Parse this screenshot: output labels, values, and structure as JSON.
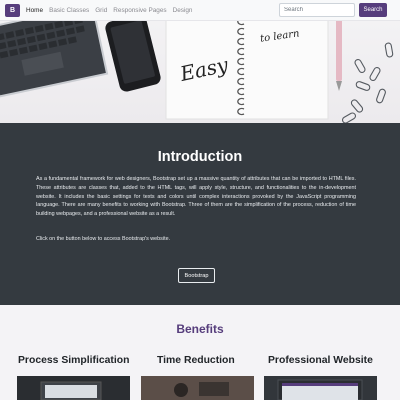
{
  "navbar": {
    "brand": "B",
    "links": [
      "Home",
      "Basic Classes",
      "Grid",
      "Responsive Pages",
      "Design"
    ],
    "search_placeholder": "Search",
    "search_button": "Search"
  },
  "hero": {
    "notebook_text_1": "Easy",
    "notebook_text_2": "to learn"
  },
  "intro": {
    "title": "Introduction",
    "paragraph": "As a fundamental framework for web designers, Bootstrap set up a massive quantity of attributes that can be imported to HTML files. These attributes are classes that, added to the HTML tags, will apply style, structure, and functionalities to the in-development website. It includes the basic settings for texts and colors until complex interactions provoked by the JavaScript programming language. There are many benefits to working with Bootstrap. Three of them are the simplification of the process, reduction of time building webpages, and a professional website as a result.",
    "cta_text": "Click on the button below to access Bootstrap's website.",
    "button": "Bootstrap"
  },
  "benefits": {
    "title": "Benefits",
    "cards": [
      {
        "title": "Process Simplification"
      },
      {
        "title": "Time Reduction"
      },
      {
        "title": "Professional Website"
      }
    ]
  },
  "colors": {
    "brand": "#563d7c",
    "dark": "#343a40",
    "light": "#f8f9fa"
  }
}
